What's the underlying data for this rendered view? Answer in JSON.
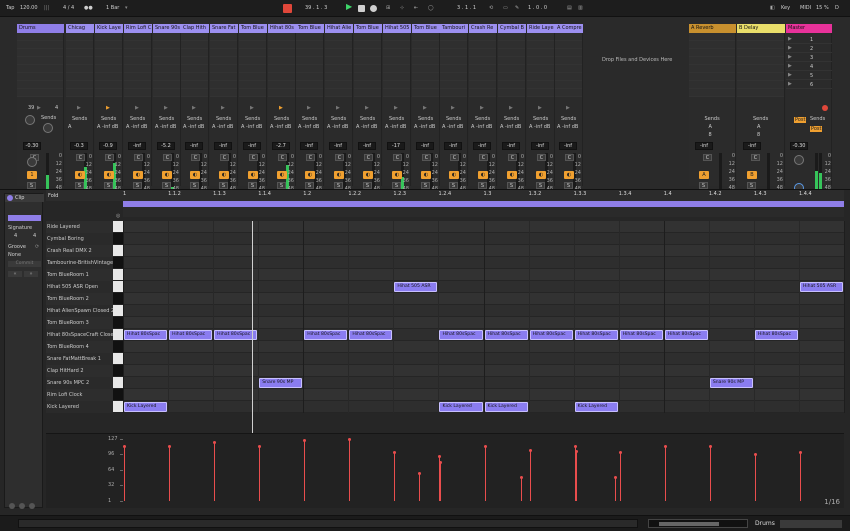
{
  "transport": {
    "tap": "Tap",
    "tempo": "120.00",
    "signature": "4 / 4",
    "quantize": "1 Bar",
    "arrangement_position": "39 .  1 .  3",
    "loop_start": "3 .  1 .  1",
    "loop_length": "1 .  0 .  0",
    "key": "Key",
    "midi": "MIDI",
    "cpu": "15 %",
    "disk": "D"
  },
  "tracks": [
    {
      "name": "Drums",
      "color": "#8f7ee8",
      "volume": "-0.30",
      "number": "1",
      "sends_a": "A",
      "sends_b": ""
    },
    {
      "name": "Chicag",
      "color": "#9c8ff0",
      "volume": "-0.3",
      "number": "",
      "sends_a": "A",
      "sends_b": ""
    },
    {
      "name": "Kick Laye",
      "color": "#9c8ff0",
      "volume": "-0.9",
      "number": "",
      "sends_a": "A",
      "sends_b": "-inf dB"
    },
    {
      "name": "Rim Lofi C",
      "color": "#9c8ff0",
      "volume": "-inf",
      "number": "",
      "sends_a": "A",
      "sends_b": "-inf dB"
    },
    {
      "name": "Snare 90s",
      "color": "#9c8ff0",
      "volume": "-5.2",
      "number": "",
      "sends_a": "A",
      "sends_b": "-inf dB"
    },
    {
      "name": "Clap Hith",
      "color": "#9c8ff0",
      "volume": "-inf",
      "number": "",
      "sends_a": "A",
      "sends_b": "-inf dB"
    },
    {
      "name": "Snare Fat",
      "color": "#9c8ff0",
      "volume": "-inf",
      "number": "",
      "sends_a": "A",
      "sends_b": "-inf dB"
    },
    {
      "name": "Tom Blue",
      "color": "#9c8ff0",
      "volume": "-inf",
      "number": "",
      "sends_a": "A",
      "sends_b": "-inf dB"
    },
    {
      "name": "Hihat 80s",
      "color": "#9c8ff0",
      "volume": "-2.7",
      "number": "",
      "sends_a": "A",
      "sends_b": "-inf dB"
    },
    {
      "name": "Tom Blue",
      "color": "#9c8ff0",
      "volume": "-inf",
      "number": "",
      "sends_a": "A",
      "sends_b": "-inf dB"
    },
    {
      "name": "Hihat Alie",
      "color": "#9c8ff0",
      "volume": "-inf",
      "number": "",
      "sends_a": "A",
      "sends_b": "-inf dB"
    },
    {
      "name": "Tom Blue",
      "color": "#9c8ff0",
      "volume": "-inf",
      "number": "",
      "sends_a": "A",
      "sends_b": "-inf dB"
    },
    {
      "name": "Hihat 505",
      "color": "#9c8ff0",
      "volume": "-17",
      "number": "",
      "sends_a": "A",
      "sends_b": "-inf dB"
    },
    {
      "name": "Tom Blue",
      "color": "#9c8ff0",
      "volume": "-inf",
      "number": "",
      "sends_a": "A",
      "sends_b": "-inf dB"
    },
    {
      "name": "Tambouri",
      "color": "#9c8ff0",
      "volume": "-inf",
      "number": "",
      "sends_a": "A",
      "sends_b": "-inf dB"
    },
    {
      "name": "Crash Re",
      "color": "#9c8ff0",
      "volume": "-inf",
      "number": "",
      "sends_a": "A",
      "sends_b": "-inf dB"
    },
    {
      "name": "Cymbal B",
      "color": "#9c8ff0",
      "volume": "-inf",
      "number": "",
      "sends_a": "A",
      "sends_b": "-inf dB"
    },
    {
      "name": "Ride Laye",
      "color": "#9c8ff0",
      "volume": "-inf",
      "number": "",
      "sends_a": "A",
      "sends_b": "-inf dB"
    },
    {
      "name": "A Compre",
      "color": "#9c8ff0",
      "volume": "-inf",
      "number": "",
      "sends_a": "A",
      "sends_b": "-inf dB"
    }
  ],
  "drop_hint": "Drop Files and Devices Here",
  "returns": [
    {
      "name": "A Reverb",
      "color": "#c8902e",
      "letter": "A",
      "volume": "-inf"
    },
    {
      "name": "B Delay",
      "color": "#e9de6a",
      "letter": "B",
      "volume": "-inf"
    }
  ],
  "master": {
    "name": "Master",
    "color": "#e8329a",
    "volume": "-0.30",
    "scenes": [
      "1",
      "2",
      "3",
      "4",
      "5",
      "6"
    ],
    "post": "Post"
  },
  "labels": {
    "sends": "Sends",
    "s": "S",
    "c": "C",
    "solo_a": "A",
    "clip_count": "4",
    "scene_num": "39",
    "eight": "8"
  },
  "meter_scale": [
    "0",
    "12",
    "24",
    "36",
    "48",
    "60"
  ],
  "clip_panel": {
    "title": "Clip",
    "signature_label": "Signature",
    "sig_num": "4",
    "sig_den": "4",
    "groove_label": "Groove",
    "groove_value": "None",
    "commit": "Commit"
  },
  "editor": {
    "fold": "Fold",
    "bar_ticks": [
      "1",
      "1.1.2",
      "1.1.3",
      "1.1.4",
      "1.2",
      "1.2.2",
      "1.2.3",
      "1.2.4",
      "1.3",
      "1.3.2",
      "1.3.3",
      "1.3.4",
      "1.4",
      "1.4.2",
      "1.4.3",
      "1.4.4"
    ],
    "lanes": [
      "Ride Layered",
      "Cymbal Boring",
      "Crash Real DMX 2",
      "Tambourine-BritishVintage",
      "Tom BlueRoom 1",
      "Hihat 505 ASR Open",
      "Tom BlueRoom 2",
      "Hihat AlienSpawn Closed 2",
      "Tom BlueRoom 3",
      "Hihat 80sSpaceCraft Closed",
      "Tom BlueRoom 4",
      "Snare FatMattBreak 1",
      "Clap HitHard 2",
      "Snare 90s MPC 2",
      "Rim Lofi Clock",
      "Kick Layered"
    ],
    "notes": [
      {
        "lane": 5,
        "start": 6,
        "len": 1,
        "label": "Hihat 505 ASR"
      },
      {
        "lane": 5,
        "start": 15,
        "len": 1,
        "label": "Hihat 505 ASR"
      },
      {
        "lane": 9,
        "start": 0,
        "len": 1,
        "label": "Hihat 80sSpac"
      },
      {
        "lane": 9,
        "start": 1,
        "len": 1,
        "label": "Hihat 80sSpac"
      },
      {
        "lane": 9,
        "start": 2,
        "len": 1,
        "label": "Hihat 80sSpac"
      },
      {
        "lane": 9,
        "start": 4,
        "len": 1,
        "label": "Hihat 80sSpac"
      },
      {
        "lane": 9,
        "start": 5,
        "len": 1,
        "label": "Hihat 80sSpac"
      },
      {
        "lane": 9,
        "start": 7,
        "len": 1,
        "label": "Hihat 80sSpac"
      },
      {
        "lane": 9,
        "start": 8,
        "len": 1,
        "label": "Hihat 80sSpac"
      },
      {
        "lane": 9,
        "start": 9,
        "len": 1,
        "label": "Hihat 80sSpac"
      },
      {
        "lane": 9,
        "start": 10,
        "len": 1,
        "label": "Hihat 80sSpac"
      },
      {
        "lane": 9,
        "start": 11,
        "len": 1,
        "label": "Hihat 80sSpac"
      },
      {
        "lane": 9,
        "start": 12,
        "len": 1,
        "label": "Hihat 80sSpac"
      },
      {
        "lane": 9,
        "start": 14,
        "len": 1,
        "label": "Hihat 80sSpac"
      },
      {
        "lane": 13,
        "start": 3,
        "len": 1,
        "label": "Snare 90s MP"
      },
      {
        "lane": 13,
        "start": 13,
        "len": 1,
        "label": "Snare 90s MP"
      },
      {
        "lane": 15,
        "start": 0,
        "len": 1,
        "label": "Kick Layered"
      },
      {
        "lane": 15,
        "start": 7,
        "len": 1,
        "label": "Kick Layered"
      },
      {
        "lane": 15,
        "start": 8,
        "len": 1,
        "label": "Kick Layered"
      },
      {
        "lane": 15,
        "start": 10,
        "len": 1,
        "label": "Kick Layered"
      }
    ],
    "velocity_scale": [
      "127",
      "96",
      "64",
      "32",
      "1"
    ],
    "velocities": [
      {
        "step": 0,
        "value": 112
      },
      {
        "step": 1,
        "value": 112
      },
      {
        "step": 2,
        "value": 120
      },
      {
        "step": 3,
        "value": 112
      },
      {
        "step": 4,
        "value": 125
      },
      {
        "step": 5,
        "value": 127
      },
      {
        "step": 6,
        "value": 100
      },
      {
        "step": 6.55,
        "value": 58
      },
      {
        "step": 7,
        "value": 92
      },
      {
        "step": 7.02,
        "value": 80
      },
      {
        "step": 8,
        "value": 112
      },
      {
        "step": 8.8,
        "value": 50
      },
      {
        "step": 9,
        "value": 104
      },
      {
        "step": 10,
        "value": 112
      },
      {
        "step": 10.02,
        "value": 102
      },
      {
        "step": 10.9,
        "value": 50
      },
      {
        "step": 11,
        "value": 100
      },
      {
        "step": 12,
        "value": 112
      },
      {
        "step": 13,
        "value": 112
      },
      {
        "step": 14,
        "value": 96
      },
      {
        "step": 15,
        "value": 100
      }
    ],
    "page_counter": "1/16"
  },
  "statusbar": {
    "track": "Drums"
  }
}
